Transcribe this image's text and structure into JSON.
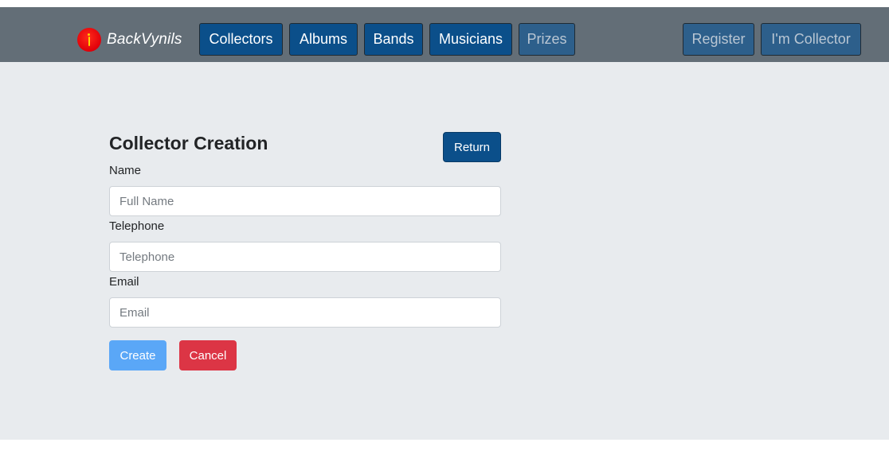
{
  "navbar": {
    "brand": "BackVynils",
    "items": [
      {
        "label": "Collectors"
      },
      {
        "label": "Albums"
      },
      {
        "label": "Bands"
      },
      {
        "label": "Musicians"
      },
      {
        "label": "Prizes"
      }
    ],
    "register_label": "Register",
    "collector_label": "I'm Collector"
  },
  "form": {
    "title": "Collector Creation",
    "return_label": "Return",
    "name_label": "Name",
    "name_placeholder": "Full Name",
    "telephone_label": "Telephone",
    "telephone_placeholder": "Telephone",
    "email_label": "Email",
    "email_placeholder": "Email",
    "create_label": "Create",
    "cancel_label": "Cancel"
  },
  "colors": {
    "navbar": "#636e77",
    "nav_button": "#0b4f8a",
    "background": "#e8ebee",
    "create": "#5aa7f7",
    "cancel": "#dc3545"
  }
}
